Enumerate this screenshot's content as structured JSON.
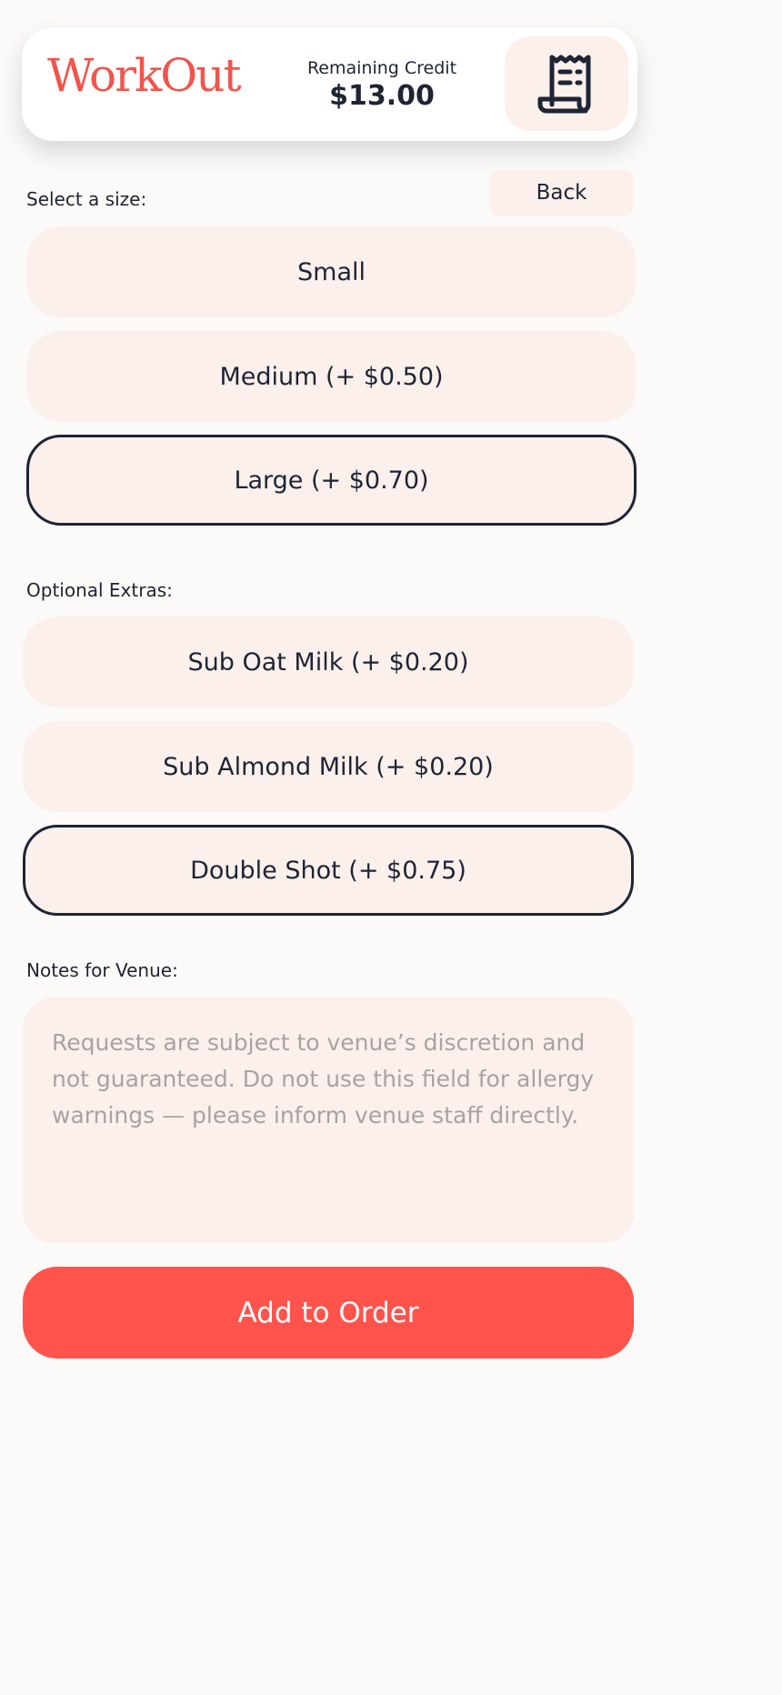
{
  "header": {
    "logo": "WorkOut",
    "credit_label": "Remaining Credit",
    "credit_value": "$13.00",
    "receipt_icon": "receipt-icon"
  },
  "size_section": {
    "label": "Select a size:",
    "back_label": "Back",
    "options": [
      {
        "label": "Small",
        "selected": false
      },
      {
        "label": "Medium (+ $0.50)",
        "selected": false
      },
      {
        "label": "Large (+ $0.70)",
        "selected": true
      }
    ]
  },
  "extras_section": {
    "label": "Optional Extras:",
    "options": [
      {
        "label": "Sub Oat Milk (+ $0.20)",
        "selected": false
      },
      {
        "label": "Sub Almond Milk (+ $0.20)",
        "selected": false
      },
      {
        "label": "Double Shot (+ $0.75)",
        "selected": true
      }
    ]
  },
  "notes_section": {
    "label": "Notes for Venue:",
    "placeholder": "Requests are subject to venue’s discretion and not guaranteed. Do not use this field for allergy warnings — please inform venue staff directly.",
    "value": ""
  },
  "add_button_label": "Add to Order",
  "colors": {
    "accent": "#ff534c",
    "option_background": "#fbf0ec",
    "text": "#1f2433"
  }
}
